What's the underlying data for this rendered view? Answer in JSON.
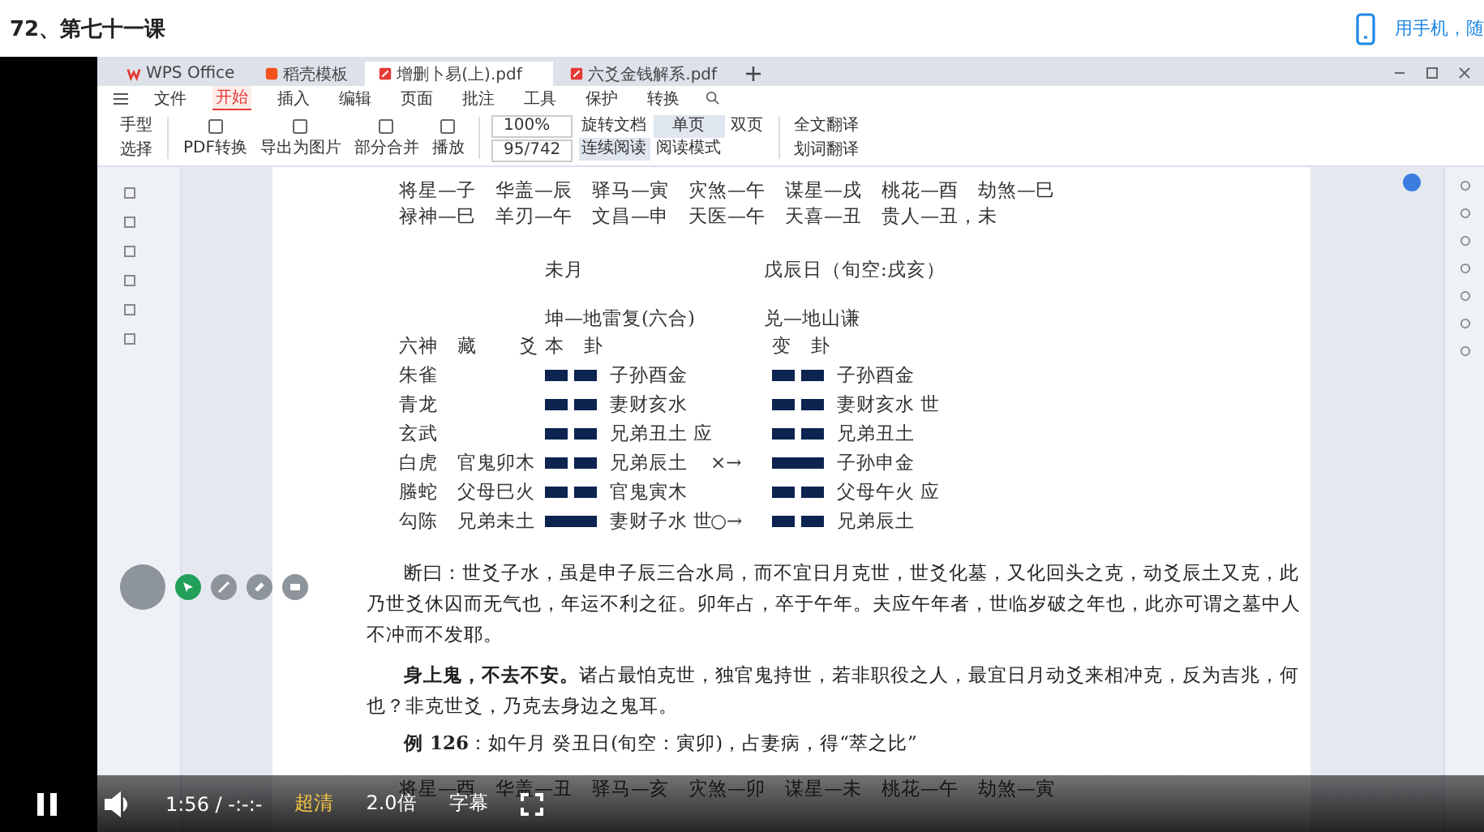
{
  "page": {
    "title": "72、第七十一课",
    "mobile_link": "用手机，随"
  },
  "app_tabs": [
    {
      "label": "WPS Office",
      "selected": false,
      "kind": "home"
    },
    {
      "label": "稻壳模板",
      "selected": false,
      "kind": "template"
    },
    {
      "label": "增删卜易(上).pdf",
      "selected": true,
      "kind": "pdf"
    },
    {
      "label": "六爻金钱解系.pdf",
      "selected": false,
      "kind": "pdf"
    }
  ],
  "menu": [
    {
      "label": "文件",
      "selected": false
    },
    {
      "label": "开始",
      "selected": true
    },
    {
      "label": "插入",
      "selected": false
    },
    {
      "label": "编辑",
      "selected": false
    },
    {
      "label": "页面",
      "selected": false
    },
    {
      "label": "批注",
      "selected": false
    },
    {
      "label": "工具",
      "selected": false
    },
    {
      "label": "保护",
      "selected": false
    },
    {
      "label": "转换",
      "selected": false
    }
  ],
  "toolbar": {
    "left": [
      "手型",
      "选择"
    ],
    "convert": [
      "PDF转换",
      "导出为图片",
      "部分合并",
      "播放"
    ],
    "zoom": "100%",
    "page": "95/742",
    "view": [
      {
        "label": "旋转文档",
        "selected": false
      },
      {
        "label": "单页",
        "selected": true
      },
      {
        "label": "双页",
        "selected": false
      },
      {
        "label": "连续阅读",
        "selected": true
      },
      {
        "label": "阅读模式",
        "selected": false
      }
    ],
    "translate": [
      "全文翻译",
      "划词翻译"
    ]
  },
  "document": {
    "shensha": [
      "将星—子　华盖—辰　驿马—寅　灾煞—午　谋星—戌　桃花—酉　劫煞—巳",
      "禄神—巳　羊刃—午　文昌—申　天医—午　天喜—丑　贵人—丑，未"
    ],
    "month": "未月",
    "day": "戊辰日（旬空:戌亥）",
    "main_gua": "坤—地雷复(六合)",
    "changed_gua": "兑—地山谦",
    "header": {
      "gods": "六神",
      "hidden": "藏",
      "yao": "爻",
      "main": "本　卦",
      "changed": "变　卦"
    },
    "rows": [
      {
        "god": "朱雀",
        "hidden": "",
        "broken": true,
        "text": "子孙酉金",
        "move": "",
        "changed_broken": true,
        "changed_text": "子孙酉金"
      },
      {
        "god": "青龙",
        "hidden": "",
        "broken": true,
        "text": "妻财亥水",
        "move": "",
        "changed_broken": true,
        "changed_text": "妻财亥水 世"
      },
      {
        "god": "玄武",
        "hidden": "",
        "broken": true,
        "text": "兄弟丑土 应",
        "move": "",
        "changed_broken": true,
        "changed_text": "兄弟丑土"
      },
      {
        "god": "白虎",
        "hidden": "官鬼卯木",
        "broken": true,
        "text": "兄弟辰土",
        "move": "×→",
        "changed_broken": false,
        "changed_text": "子孙申金"
      },
      {
        "god": "螣蛇",
        "hidden": "父母巳火",
        "broken": true,
        "text": "官鬼寅木",
        "move": "",
        "changed_broken": true,
        "changed_text": "父母午火 应"
      },
      {
        "god": "勾陈",
        "hidden": "兄弟未土",
        "broken": false,
        "text": "妻财子水 世",
        "move": "○→",
        "changed_broken": true,
        "changed_text": "兄弟辰土"
      }
    ],
    "paragraphs": [
      "断曰：世爻子水，虽是申子辰三合水局，而不宜日月克世，世爻化墓，又化回头之克，动爻辰土又克，此乃世爻休囚而无气也，年运不利之征。卯年占，卒于午年。夫应午年者，世临岁破之年也，此亦可谓之墓中人不冲而不发耶。",
      "**身上鬼，不去不安。**诸占最怕克世，独官鬼持世，若非职役之人，最宜日月动爻来相冲克，反为吉兆，何也？非克世爻，乃克去身边之鬼耳。"
    ],
    "example": "**例 126**：如午月 癸丑日(旬空：寅卯)，占妻病，得“萃之比”",
    "cut_line": "将星—酉　华盖—丑　驿马—亥　灾煞—卯　谋星—未　桃花—午　劫煞—寅"
  },
  "player": {
    "playing": true,
    "time": "1:56 / -:-:-",
    "quality": "超清",
    "speed": "2.0倍",
    "subtitles": "字幕"
  }
}
